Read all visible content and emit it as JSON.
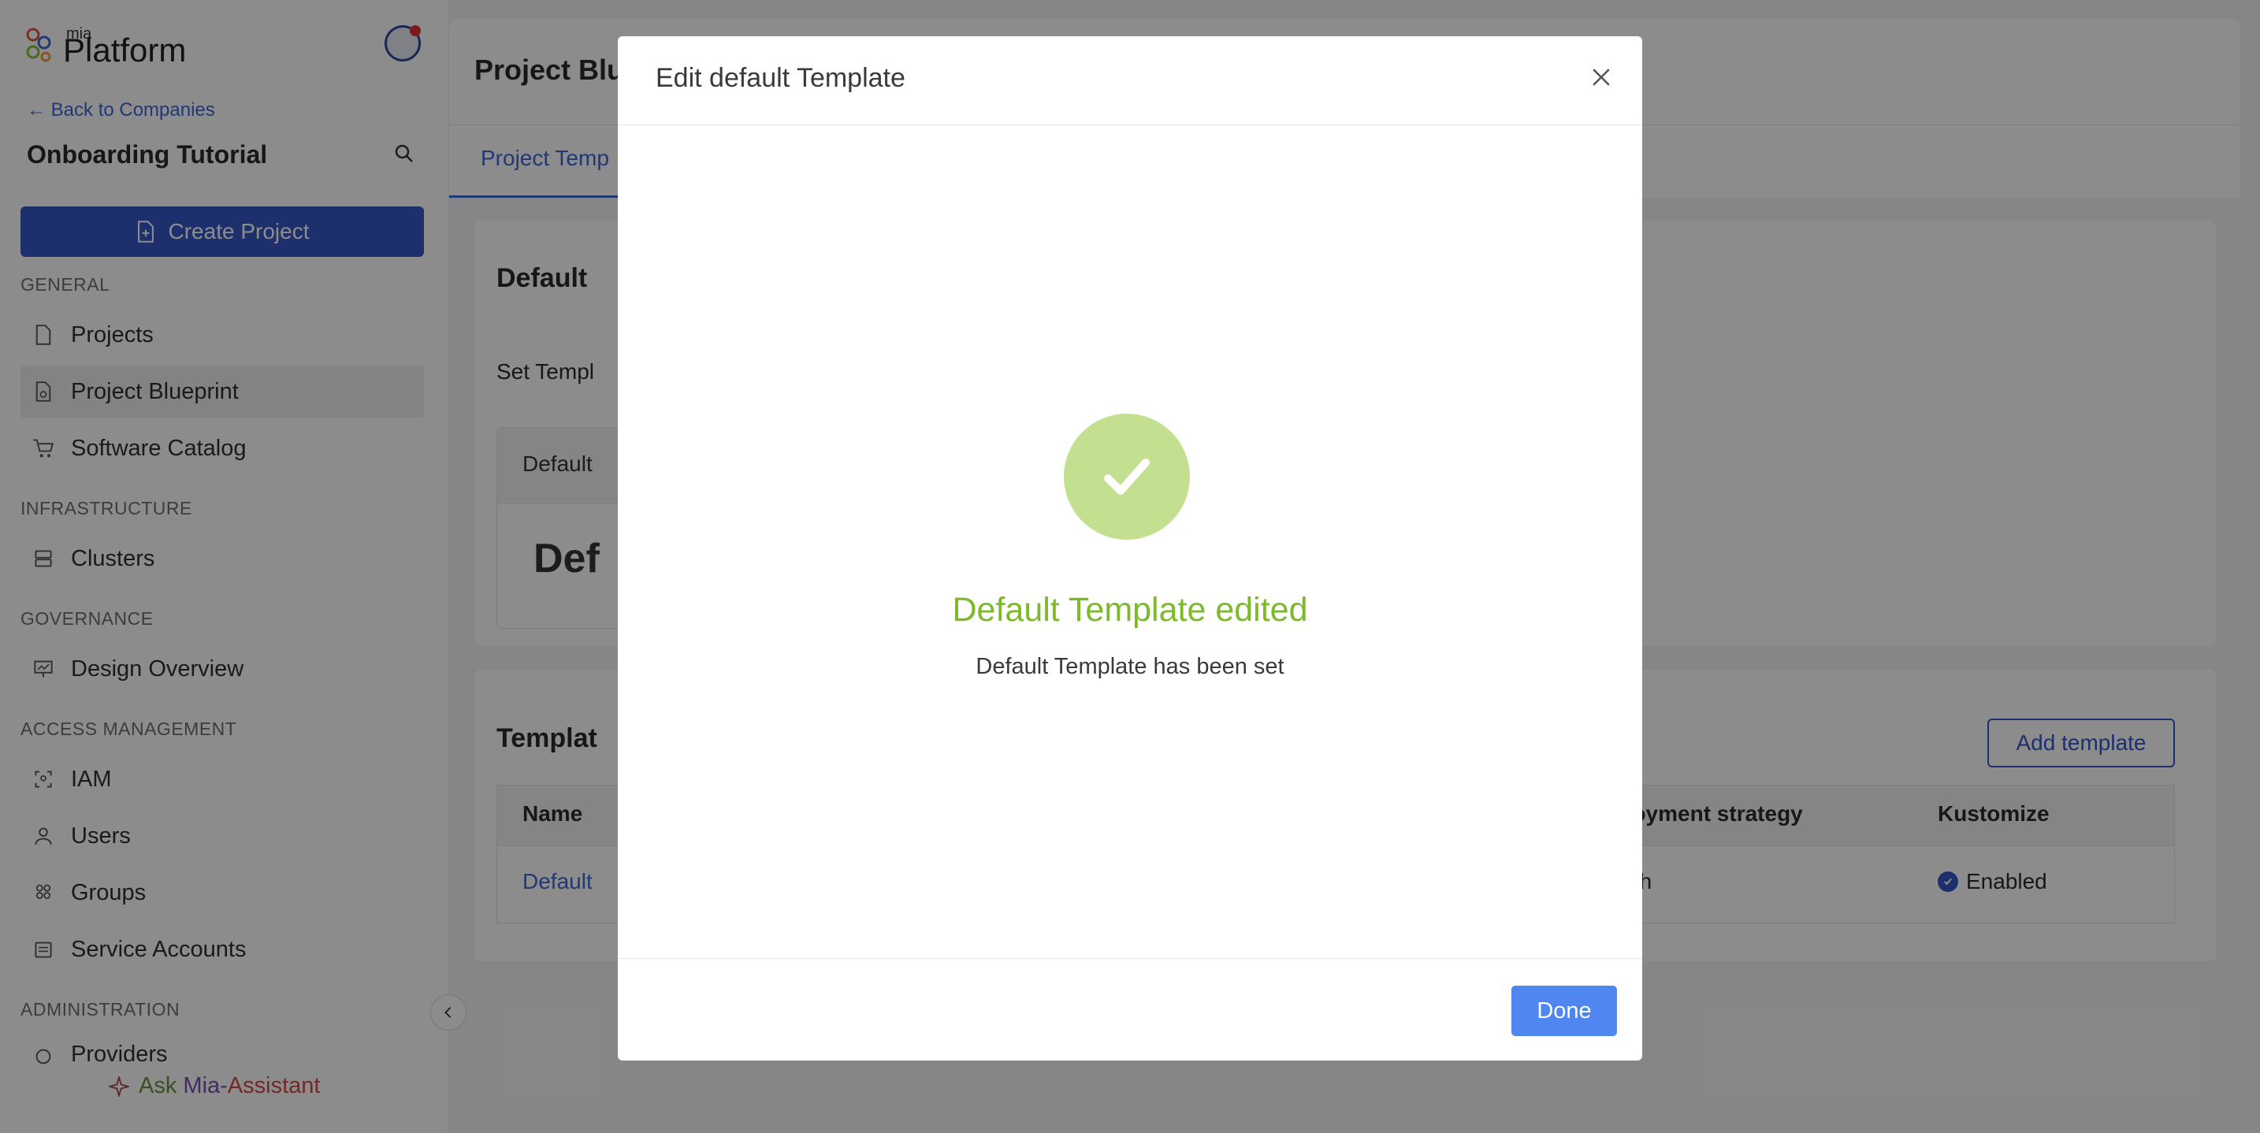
{
  "sidebar": {
    "logo_small": "mia",
    "logo_main": "Platform",
    "back_label": "Back to Companies",
    "company_name": "Onboarding Tutorial",
    "create_project_label": "Create Project",
    "sections": {
      "general": "GENERAL",
      "infrastructure": "INFRASTRUCTURE",
      "governance": "GOVERNANCE",
      "access_management": "ACCESS MANAGEMENT",
      "administration": "ADMINISTRATION"
    },
    "items": {
      "projects": "Projects",
      "project_blueprint": "Project Blueprint",
      "software_catalog": "Software Catalog",
      "clusters": "Clusters",
      "design_overview": "Design Overview",
      "iam": "IAM",
      "users": "Users",
      "groups": "Groups",
      "service_accounts": "Service Accounts",
      "providers": "Providers"
    },
    "ask_prefix": "Ask",
    "ask_mia": "Mia-",
    "ask_assistant": "Assistant"
  },
  "main": {
    "title": "Project Blu",
    "tab_active": "Project Temp",
    "default_card": {
      "heading": "Default",
      "set_template_label": "Set Templ",
      "box_label": "Default",
      "box_value": "Def"
    },
    "templates_card": {
      "heading": "Templat",
      "add_button": "Add template",
      "columns": {
        "name": "Name",
        "deployment": "eployment strategy",
        "kustomize": "Kustomize"
      },
      "row": {
        "name": "Default",
        "deployment": "ush",
        "kustomize": "Enabled"
      }
    }
  },
  "modal": {
    "title": "Edit default Template",
    "success_title": "Default Template edited",
    "success_subtitle": "Default Template has been set",
    "done_label": "Done"
  },
  "colors": {
    "primary": "#3557c7",
    "link": "#3b67d6",
    "success": "#7cba2a",
    "success_icon_bg": "#c2e08f",
    "done_button": "#4f86ef"
  }
}
